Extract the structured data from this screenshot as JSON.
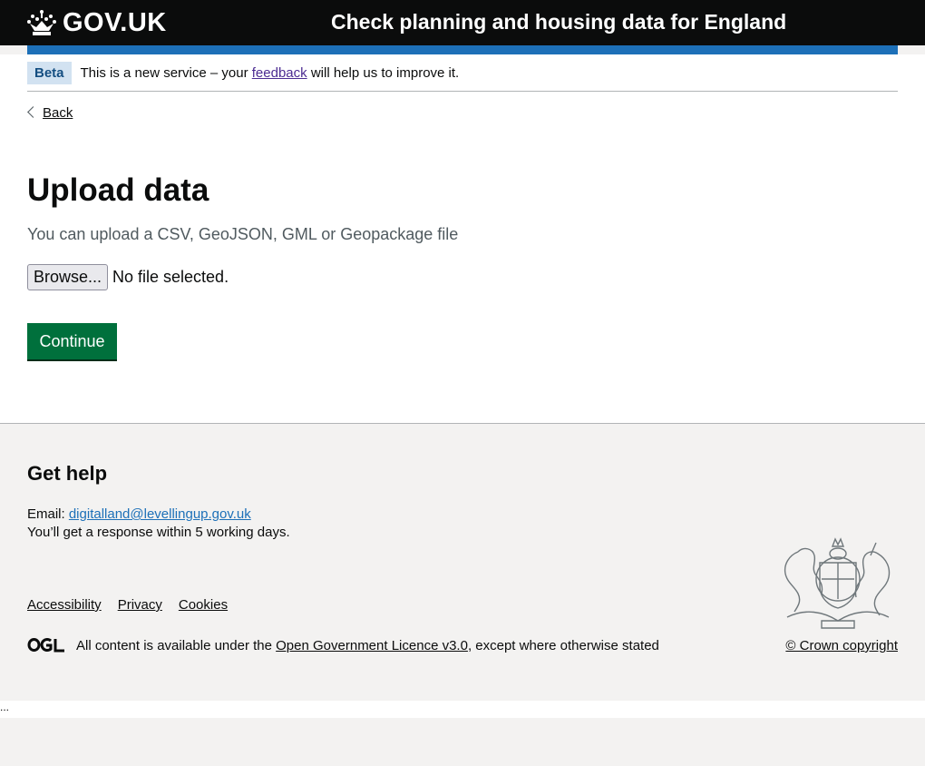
{
  "header": {
    "logo_text": "GOV.UK",
    "service_name": "Check planning and housing data for England",
    "crown_icon": "crown-icon"
  },
  "phase_banner": {
    "tag": "Beta",
    "text_before": "This is a new service – your ",
    "link": "feedback",
    "text_after": " will help us to improve it."
  },
  "back_link": "Back",
  "page": {
    "title": "Upload data",
    "hint": "You can upload a CSV, GeoJSON, GML or Geopackage file",
    "browse_label": "Browse...",
    "file_status": "No file selected.",
    "continue_label": "Continue"
  },
  "footer": {
    "help_title": "Get help",
    "email_label": "Email: ",
    "email": "digitalland@levellingup.gov.uk",
    "response": "You’ll get a response within 5 working days.",
    "links": [
      "Accessibility",
      "Privacy",
      "Cookies"
    ],
    "ogl_text": "OGL",
    "licence_before": "All content is available under the ",
    "licence_link": "Open Government Licence v3.0",
    "licence_after": ", except where otherwise stated",
    "copyright": "© Crown copyright",
    "crest_icon": "royal-coat-of-arms-icon"
  },
  "bottom_strip_text": "...",
  "colors": {
    "header_bg": "#0b0c0c",
    "blue_bar": "#1d70b8",
    "button_green": "#00703c",
    "visited_link": "#4c2c92",
    "beta_tag_bg": "#d2e2f1",
    "footer_bg": "#f3f2f1"
  }
}
